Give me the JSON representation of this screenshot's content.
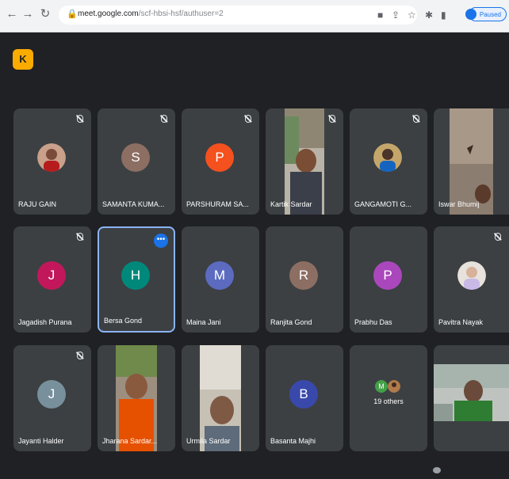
{
  "browser": {
    "url_host": "meet.google.com",
    "url_path": "/scf-hbsi-hsf/authuser=2",
    "profile_status": "Paused"
  },
  "meet": {
    "logo_letter": "K",
    "others_label": "19 others",
    "participants": [
      {
        "name": "RAJU GAIN",
        "kind": "photo",
        "muted": true
      },
      {
        "name": "SAMANTA KUMA...",
        "kind": "initial",
        "initial": "S",
        "color": "#8d6e63",
        "muted": true
      },
      {
        "name": "PARSHURAM SA...",
        "kind": "initial",
        "initial": "P",
        "color": "#f4511e",
        "muted": true
      },
      {
        "name": "Kartik Sardar",
        "kind": "video",
        "muted": true
      },
      {
        "name": "GANGAMOTI G...",
        "kind": "photo",
        "muted": true
      },
      {
        "name": "Iswar Bhumij",
        "kind": "video",
        "muted": false
      },
      {
        "name": "Jagadish Purana",
        "kind": "initial",
        "initial": "J",
        "color": "#c2185b",
        "muted": true
      },
      {
        "name": "Bersa Gond",
        "kind": "initial",
        "initial": "H",
        "color": "#00897b",
        "muted": false,
        "active": true
      },
      {
        "name": "Maina Jani",
        "kind": "initial",
        "initial": "M",
        "color": "#5c6bc0",
        "muted": false
      },
      {
        "name": "Ranjita Gond",
        "kind": "initial",
        "initial": "R",
        "color": "#8d6e63",
        "muted": false
      },
      {
        "name": "Prabhu Das",
        "kind": "initial",
        "initial": "P",
        "color": "#ab47bc",
        "muted": false
      },
      {
        "name": "Pavitra Nayak",
        "kind": "photo",
        "muted": true
      },
      {
        "name": "Jayanti Halder",
        "kind": "initial",
        "initial": "J",
        "color": "#78909c",
        "muted": true
      },
      {
        "name": "Jharana Sardar...",
        "kind": "video",
        "muted": false
      },
      {
        "name": "Urmila Sardar",
        "kind": "video",
        "muted": false
      },
      {
        "name": "Basanta Majhi",
        "kind": "initial",
        "initial": "B",
        "color": "#3949ab",
        "muted": false
      }
    ]
  },
  "icons": {
    "back": "back-arrow-icon",
    "forward": "forward-arrow-icon",
    "reload": "reload-icon",
    "lock": "lock-icon",
    "cast": "cast-icon",
    "share": "share-icon",
    "bookmark": "star-icon",
    "extensions": "puzzle-icon",
    "sidepanel": "side-panel-icon",
    "more_options": "more-options-icon",
    "mic_off": "mic-off-icon"
  },
  "colors": {
    "meet_background": "#202124",
    "tile_background": "#3c4043",
    "active_border": "#8ab4f8",
    "accent_blue": "#1a73e8"
  }
}
